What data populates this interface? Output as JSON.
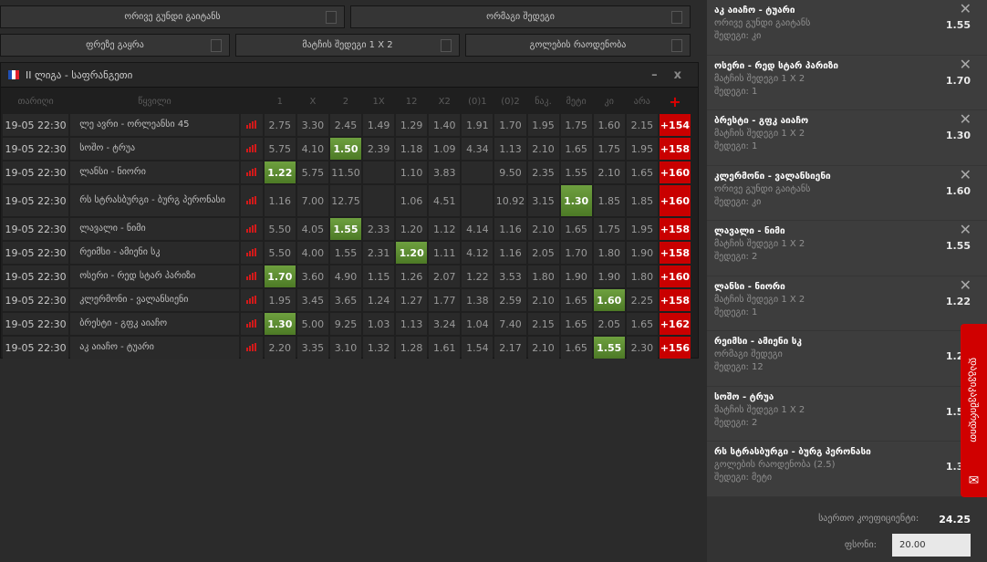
{
  "filters": [
    {
      "label": "ორივე გუნდი გაიტანს",
      "checked": false
    },
    {
      "label": "ორმაგი შედეგი",
      "checked": false
    },
    {
      "label": "ფრეზე გაყრა",
      "checked": false
    },
    {
      "label": "მატჩის შედეგი 1 X 2",
      "checked": false
    },
    {
      "label": "გოლების რაოდენობა",
      "checked": false
    }
  ],
  "league": {
    "title": "II ლიგა - საფრანგეთი",
    "flag_colors": [
      "#1f4fb5",
      "#ffffff",
      "#e0212d"
    ],
    "minimize": "–",
    "close": "x"
  },
  "columns": {
    "date": "თარიღი",
    "match": "წყვილი",
    "odds": [
      "1",
      "X",
      "2",
      "1X",
      "12",
      "X2",
      "(0)1",
      "(0)2",
      "ნაკ.",
      "მეტი",
      "კი",
      "არა"
    ],
    "plus": "+"
  },
  "rows": [
    {
      "date": "19-05 22:30",
      "match": "ლე ავრი - ორლეანსი 45",
      "odds": [
        "2.75",
        "3.30",
        "2.45",
        "1.49",
        "1.29",
        "1.40",
        "1.91",
        "1.70",
        "1.95",
        "1.75",
        "1.60",
        "2.15"
      ],
      "selected": -1,
      "more": "+154"
    },
    {
      "date": "19-05 22:30",
      "match": "სოშო - ტრუა",
      "odds": [
        "5.75",
        "4.10",
        "1.50",
        "2.39",
        "1.18",
        "1.09",
        "4.34",
        "1.13",
        "2.10",
        "1.65",
        "1.75",
        "1.95"
      ],
      "selected": 2,
      "more": "+158"
    },
    {
      "date": "19-05 22:30",
      "match": "ლანსი - ნიორი",
      "odds": [
        "1.22",
        "5.75",
        "11.50",
        "",
        "1.10",
        "3.83",
        "",
        "9.50",
        "2.35",
        "1.55",
        "2.10",
        "1.65"
      ],
      "selected": 0,
      "more": "+160"
    },
    {
      "date": "19-05 22:30",
      "match": "რს სტრასბურგი - ბურგ პერონასი",
      "odds": [
        "1.16",
        "7.00",
        "12.75",
        "",
        "1.06",
        "4.51",
        "",
        "10.92",
        "3.15",
        "1.30",
        "1.85",
        "1.85"
      ],
      "selected": 9,
      "more": "+160"
    },
    {
      "date": "19-05 22:30",
      "match": "ლავალი - ნიმი",
      "odds": [
        "5.50",
        "4.05",
        "1.55",
        "2.33",
        "1.20",
        "1.12",
        "4.14",
        "1.16",
        "2.10",
        "1.65",
        "1.75",
        "1.95"
      ],
      "selected": 2,
      "more": "+158"
    },
    {
      "date": "19-05 22:30",
      "match": "რეიმსი - ამიენი სკ",
      "odds": [
        "5.50",
        "4.00",
        "1.55",
        "2.31",
        "1.20",
        "1.11",
        "4.12",
        "1.16",
        "2.05",
        "1.70",
        "1.80",
        "1.90"
      ],
      "selected": 4,
      "more": "+158"
    },
    {
      "date": "19-05 22:30",
      "match": "ოსერი - რედ სტარ პარიზი",
      "odds": [
        "1.70",
        "3.60",
        "4.90",
        "1.15",
        "1.26",
        "2.07",
        "1.22",
        "3.53",
        "1.80",
        "1.90",
        "1.90",
        "1.80"
      ],
      "selected": 0,
      "more": "+160"
    },
    {
      "date": "19-05 22:30",
      "match": "კლერმონი - ვალანსიენი",
      "odds": [
        "1.95",
        "3.45",
        "3.65",
        "1.24",
        "1.27",
        "1.77",
        "1.38",
        "2.59",
        "2.10",
        "1.65",
        "1.60",
        "2.25"
      ],
      "selected": 10,
      "more": "+158"
    },
    {
      "date": "19-05 22:30",
      "match": "ბრესტი - გფკ აიაჩო",
      "odds": [
        "1.30",
        "5.00",
        "9.25",
        "1.03",
        "1.13",
        "3.24",
        "1.04",
        "7.40",
        "2.15",
        "1.65",
        "2.05",
        "1.65"
      ],
      "selected": 0,
      "more": "+162"
    },
    {
      "date": "19-05 22:30",
      "match": "აკ აიაჩო - ტუარი",
      "odds": [
        "2.20",
        "3.35",
        "3.10",
        "1.32",
        "1.28",
        "1.61",
        "1.54",
        "2.17",
        "2.10",
        "1.65",
        "1.55",
        "2.30"
      ],
      "selected": 10,
      "more": "+156"
    }
  ],
  "slip": {
    "items": [
      {
        "match": "აკ აიაჩო - ტუარი",
        "market": "ორივე გუნდი გაიტანს",
        "result": "შედეგი: კი",
        "odd": "1.55"
      },
      {
        "match": "ოსერი - რედ სტარ პარიზი",
        "market": "მატჩის შედეგი 1 X 2",
        "result": "შედეგი: 1",
        "odd": "1.70"
      },
      {
        "match": "ბრესტი - გფკ აიაჩო",
        "market": "მატჩის შედეგი 1 X 2",
        "result": "შედეგი: 1",
        "odd": "1.30"
      },
      {
        "match": "კლერმონი - ვალანსიენი",
        "market": "ორივე გუნდი გაიტანს",
        "result": "შედეგი: კი",
        "odd": "1.60"
      },
      {
        "match": "ლავალი - ნიმი",
        "market": "მატჩის შედეგი 1 X 2",
        "result": "შედეგი: 2",
        "odd": "1.55"
      },
      {
        "match": "ლანსი - ნიორი",
        "market": "მატჩის შედეგი 1 X 2",
        "result": "შედეგი: 1",
        "odd": "1.22"
      },
      {
        "match": "რეიმსი - ამიენი სკ",
        "market": "ორმაგი შედეგი",
        "result": "შედეგი: 12",
        "odd": "1.20"
      },
      {
        "match": "სოშო - ტრუა",
        "market": "მატჩის შედეგი 1 X 2",
        "result": "შედეგი: 2",
        "odd": "1.50"
      },
      {
        "match": "რს სტრასბურგი - ბურგ პერონასი",
        "market": "გოლების რაოდენობა (2.5)",
        "result": "შედეგი: მეტი",
        "odd": "1.30"
      }
    ],
    "total_label": "საერთო კოეფიციენტი:",
    "total_value": "24.25",
    "stake_label": "ფსონი:",
    "stake_value": "20.00"
  },
  "contact": {
    "label": "დაგვიკავშირდით",
    "icon": "envelope-icon",
    "color": "#d00000"
  }
}
